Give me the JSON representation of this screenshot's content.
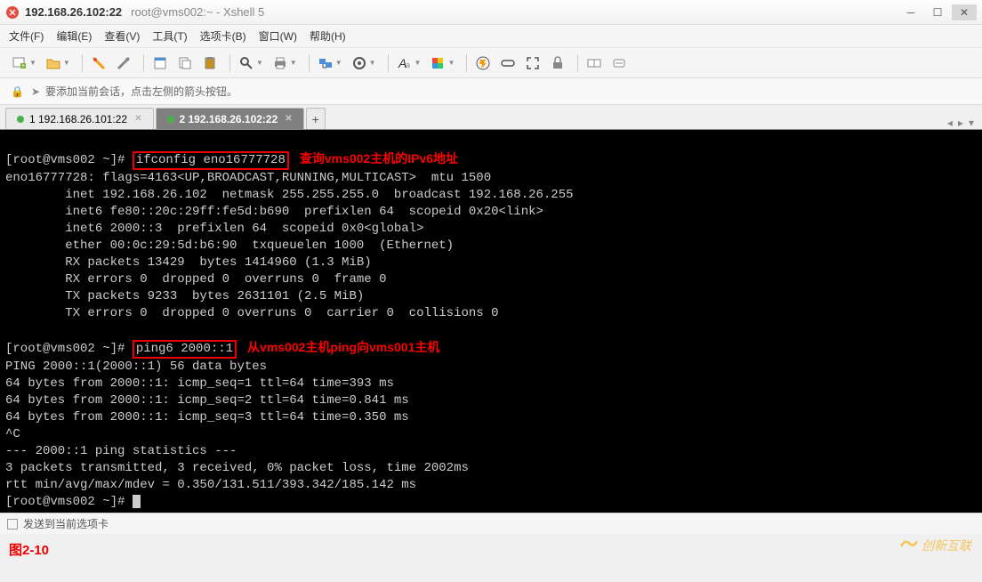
{
  "window": {
    "title_main": "192.168.26.102:22",
    "title_sub": "root@vms002:~ - Xshell 5"
  },
  "menu": {
    "file": "文件(F)",
    "edit": "编辑(E)",
    "view": "查看(V)",
    "tools": "工具(T)",
    "tab": "选项卡(B)",
    "window": "窗口(W)",
    "help": "帮助(H)"
  },
  "hint": {
    "text": "要添加当前会话，点击左侧的箭头按钮。"
  },
  "tabs": {
    "tab1": "1 192.168.26.101:22",
    "tab2": "2 192.168.26.102:22",
    "add": "+"
  },
  "term": {
    "l1_prompt": "[root@vms002 ~]# ",
    "l1_cmd": "ifconfig eno16777728",
    "l1_anno": "查询vms002主机的IPv6地址",
    "l2": "eno16777728: flags=4163<UP,BROADCAST,RUNNING,MULTICAST>  mtu 1500",
    "l3": "        inet 192.168.26.102  netmask 255.255.255.0  broadcast 192.168.26.255",
    "l4": "        inet6 fe80::20c:29ff:fe5d:b690  prefixlen 64  scopeid 0x20<link>",
    "l5": "        inet6 2000::3  prefixlen 64  scopeid 0x0<global>",
    "l6": "        ether 00:0c:29:5d:b6:90  txqueuelen 1000  (Ethernet)",
    "l7": "        RX packets 13429  bytes 1414960 (1.3 MiB)",
    "l8": "        RX errors 0  dropped 0  overruns 0  frame 0",
    "l9": "        TX packets 9233  bytes 2631101 (2.5 MiB)",
    "l10": "        TX errors 0  dropped 0 overruns 0  carrier 0  collisions 0",
    "blank": "",
    "l11_prompt": "[root@vms002 ~]# ",
    "l11_cmd": "ping6 2000::1",
    "l11_anno": "从vms002主机ping向vms001主机",
    "l12": "PING 2000::1(2000::1) 56 data bytes",
    "l13": "64 bytes from 2000::1: icmp_seq=1 ttl=64 time=393 ms",
    "l14": "64 bytes from 2000::1: icmp_seq=2 ttl=64 time=0.841 ms",
    "l15": "64 bytes from 2000::1: icmp_seq=3 ttl=64 time=0.350 ms",
    "l16": "^C",
    "l17": "--- 2000::1 ping statistics ---",
    "l18": "3 packets transmitted, 3 received, 0% packet loss, time 2002ms",
    "l19": "rtt min/avg/max/mdev = 0.350/131.511/393.342/185.142 ms",
    "l20": "[root@vms002 ~]# "
  },
  "status": {
    "text": "发送到当前选项卡"
  },
  "figure": {
    "label": "图2-10"
  },
  "watermark": {
    "text": "创新互联"
  }
}
